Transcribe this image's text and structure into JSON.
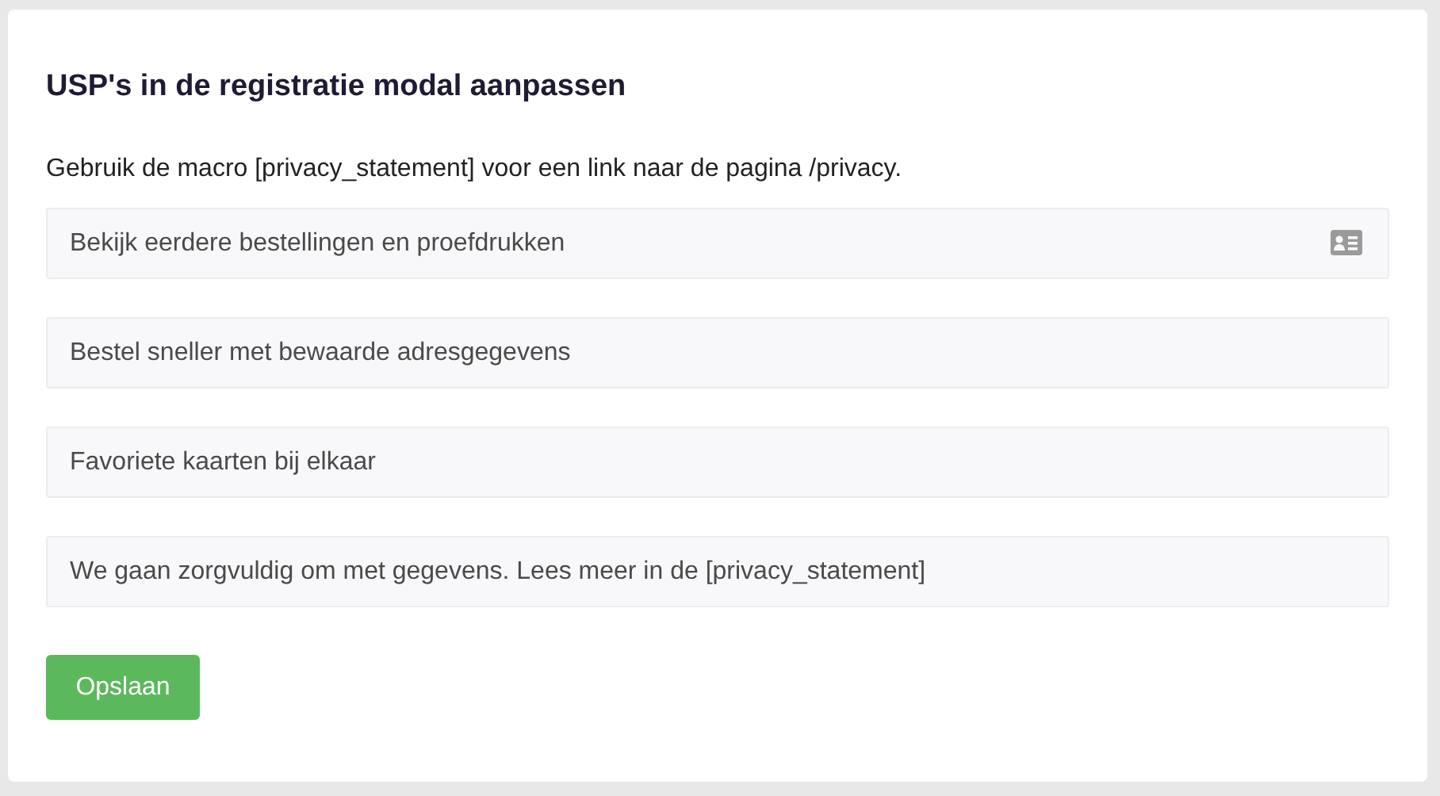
{
  "title": "USP's in de registratie modal aanpassen",
  "description": "Gebruik de macro [privacy_statement] voor een link naar de pagina /privacy.",
  "fields": [
    {
      "value": "Bekijk eerdere bestellingen en proefdrukken",
      "contact_card_icon": true
    },
    {
      "value": "Bestel sneller met bewaarde adresgegevens",
      "contact_card_icon": false
    },
    {
      "value": "Favoriete kaarten bij elkaar",
      "contact_card_icon": false
    },
    {
      "value": "We gaan zorgvuldig om met gegevens. Lees meer in de [privacy_statement]",
      "contact_card_icon": false
    }
  ],
  "save_button": "Opslaan"
}
